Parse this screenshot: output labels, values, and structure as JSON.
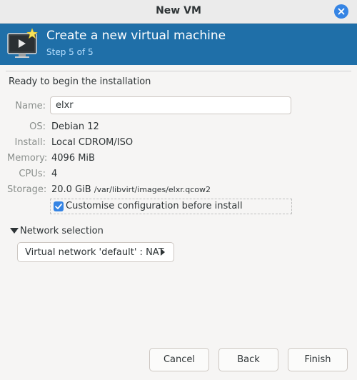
{
  "window": {
    "title": "New VM",
    "close_icon": "close-icon"
  },
  "banner": {
    "title": "Create a new virtual machine",
    "step": "Step 5 of 5",
    "icon": "virtual-machine-icon",
    "colors": {
      "background": "#1f6fa8",
      "step_text": "#b8e0ff"
    }
  },
  "summary": {
    "heading": "Ready to begin the installation",
    "name": {
      "label": "Name:",
      "value": "elxr"
    },
    "os": {
      "label": "OS:",
      "value": "Debian 12"
    },
    "install": {
      "label": "Install:",
      "value": "Local CDROM/ISO"
    },
    "memory": {
      "label": "Memory:",
      "value": "4096 MiB"
    },
    "cpus": {
      "label": "CPUs:",
      "value": "4"
    },
    "storage": {
      "label": "Storage:",
      "size": "20.0 GiB",
      "path": "/var/libvirt/images/elxr.qcow2"
    }
  },
  "customise": {
    "label": "Customise configuration before install",
    "checked": true
  },
  "network": {
    "expander_label": "Network selection",
    "expanded": true,
    "selection": "Virtual network 'default' : NAT"
  },
  "buttons": {
    "cancel": "Cancel",
    "back": "Back",
    "finish": "Finish"
  },
  "accent_color": "#3584e4"
}
